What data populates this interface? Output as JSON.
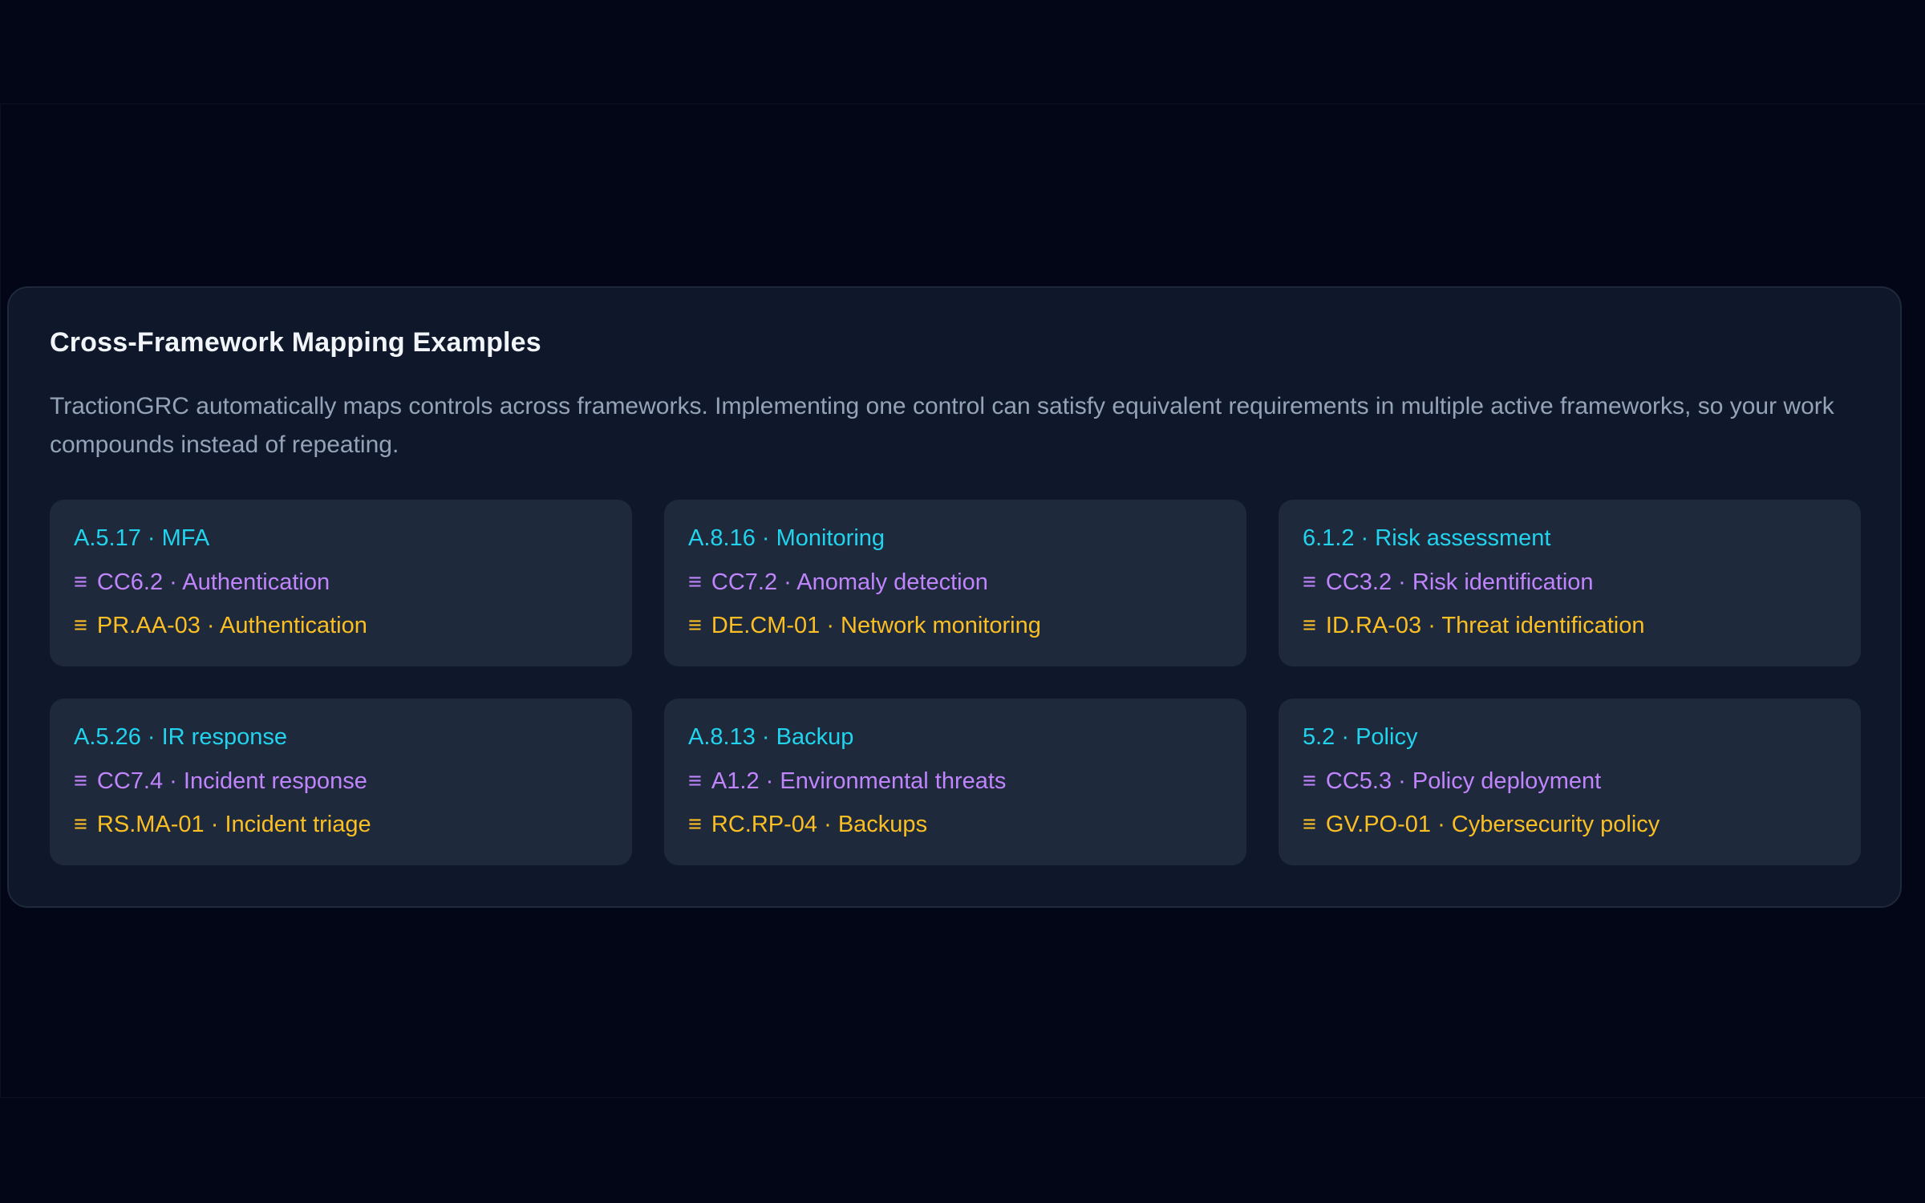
{
  "panel": {
    "title": "Cross-Framework Mapping Examples",
    "description": "TractionGRC automatically maps controls across frameworks. Implementing one control can satisfy equivalent requirements in multiple active frameworks, so your work compounds instead of repeating."
  },
  "equivalence_symbol": "≡",
  "colors": {
    "background": "#020617",
    "panel": "#0f172a",
    "card": "#1e293b",
    "iso": "#22d3ee",
    "soc": "#c084fc",
    "nist": "#fbbf24"
  },
  "mappings": [
    {
      "primary": "A.5.17 · MFA",
      "soc": "CC6.2 · Authentication",
      "nist": "PR.AA-03 · Authentication"
    },
    {
      "primary": "A.8.16 · Monitoring",
      "soc": "CC7.2 · Anomaly detection",
      "nist": "DE.CM-01 · Network monitoring"
    },
    {
      "primary": "6.1.2 · Risk assessment",
      "soc": "CC3.2 · Risk identification",
      "nist": "ID.RA-03 · Threat identification"
    },
    {
      "primary": "A.5.26 · IR response",
      "soc": "CC7.4 · Incident response",
      "nist": "RS.MA-01 · Incident triage"
    },
    {
      "primary": "A.8.13 · Backup",
      "soc": "A1.2 · Environmental threats",
      "nist": "RC.RP-04 · Backups"
    },
    {
      "primary": "5.2 · Policy",
      "soc": "CC5.3 · Policy deployment",
      "nist": "GV.PO-01 · Cybersecurity policy"
    }
  ]
}
